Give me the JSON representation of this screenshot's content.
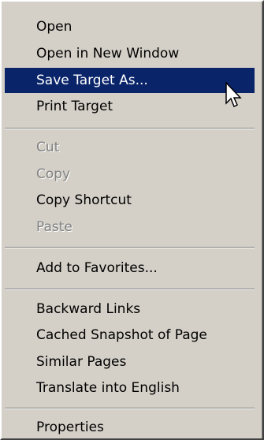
{
  "menu": {
    "items": [
      {
        "label": "Open"
      },
      {
        "label": "Open in New Window"
      },
      {
        "label": "Save Target As..."
      },
      {
        "label": "Print Target"
      },
      {
        "label": "Cut"
      },
      {
        "label": "Copy"
      },
      {
        "label": "Copy Shortcut"
      },
      {
        "label": "Paste"
      },
      {
        "label": "Add to Favorites..."
      },
      {
        "label": "Backward Links"
      },
      {
        "label": "Cached Snapshot of Page"
      },
      {
        "label": "Similar Pages"
      },
      {
        "label": "Translate into English"
      },
      {
        "label": "Properties"
      }
    ],
    "highlighted_index": 2,
    "disabled_indices": [
      4,
      5,
      7
    ]
  },
  "colors": {
    "menu_bg": "#d4d0c8",
    "highlight_bg": "#0a246a",
    "highlight_text": "#ffffff",
    "disabled_text": "#808080"
  },
  "cursor": {
    "icon": "arrow-pointer-icon"
  }
}
